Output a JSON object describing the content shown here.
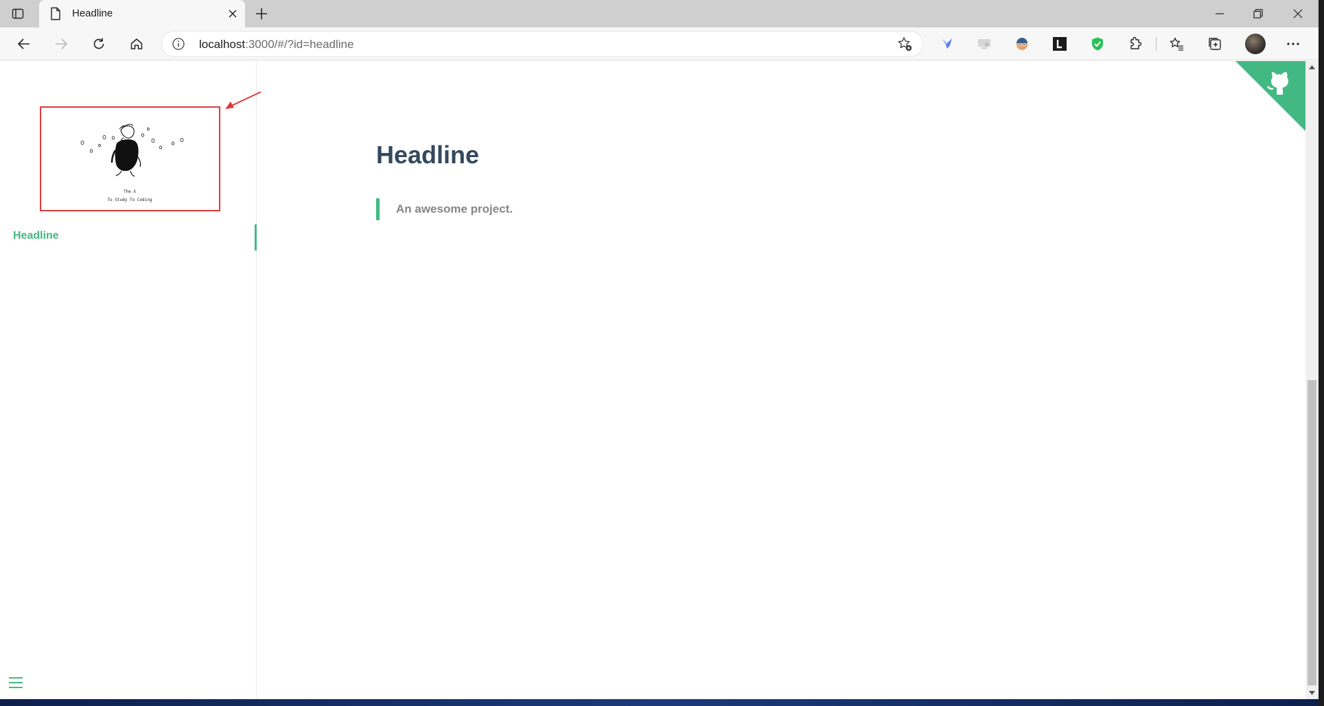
{
  "browser": {
    "tab": {
      "title": "Headline"
    },
    "address": {
      "host": "localhost",
      "rest": ":3000/#/?id=headline"
    }
  },
  "icons": {
    "tab_actions": "tab-actions-icon",
    "page": "document-icon",
    "close": "close-icon",
    "new_tab": "plus-icon",
    "back": "back-arrow-icon",
    "forward": "forward-arrow-icon",
    "refresh": "refresh-icon",
    "home": "home-icon",
    "info": "info-icon",
    "favorite_add": "star-plus-icon",
    "extensions": [
      "bird-extension-icon",
      "screen-extension-icon",
      "face-extension-icon",
      "l-extension-icon",
      "shield-extension-icon",
      "puzzle-icon"
    ],
    "favorites": "favorites-icon",
    "collections": "collections-icon",
    "more": "more-icon"
  },
  "sidebar": {
    "logo": {
      "line1": "The X",
      "line2": "To Study To Coding"
    },
    "items": [
      {
        "label": "Headline",
        "active": true
      }
    ]
  },
  "content": {
    "title": "Headline",
    "quote": "An awesome project."
  },
  "colors": {
    "accent": "#42b983",
    "title": "#34495e",
    "quote_text": "#858585",
    "annotation": "#e03a3a"
  }
}
